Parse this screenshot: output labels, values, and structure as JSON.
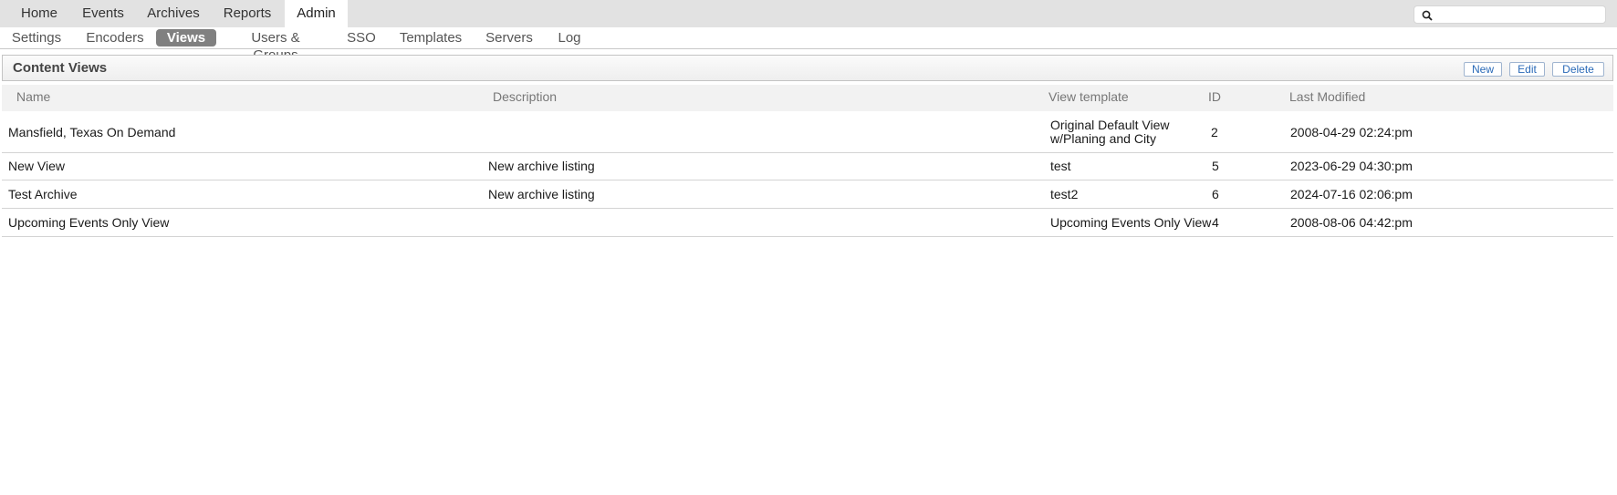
{
  "top_nav": {
    "tabs": [
      "Home",
      "Events",
      "Archives",
      "Reports",
      "Admin"
    ],
    "active": "Admin"
  },
  "search": {
    "placeholder": "",
    "value": "",
    "icon": "search-icon"
  },
  "sub_nav": {
    "tabs": [
      "Settings",
      "Encoders",
      "Views",
      "Users & Groups",
      "SSO",
      "Templates",
      "Servers",
      "Log"
    ],
    "active": "Views"
  },
  "panel": {
    "title": "Content Views",
    "buttons": {
      "new": "New",
      "edit": "Edit",
      "delete": "Delete"
    }
  },
  "table": {
    "columns": {
      "name": "Name",
      "description": "Description",
      "template": "View template",
      "id": "ID",
      "modified": "Last Modified"
    },
    "rows": [
      {
        "name": "Mansfield, Texas On Demand",
        "description": "",
        "template_line1": "Original Default View",
        "template_line2": "w/Planing and City",
        "id": "2",
        "modified": "2008-04-29 02:24:pm"
      },
      {
        "name": "New View",
        "description": "New archive listing",
        "template_line1": "test",
        "template_line2": "",
        "id": "5",
        "modified": "2023-06-29 04:30:pm"
      },
      {
        "name": "Test Archive",
        "description": "New archive listing",
        "template_line1": "test2",
        "template_line2": "",
        "id": "6",
        "modified": "2024-07-16 02:06:pm"
      },
      {
        "name": "Upcoming Events Only View",
        "description": "",
        "template_line1": "Upcoming Events Only View",
        "template_line2": "",
        "id": "4",
        "modified": "2008-08-06 04:42:pm"
      }
    ]
  },
  "colors": {
    "topbar_bg": "#e2e2e2",
    "active_subtab_bg": "#808080",
    "button_text": "#2a6ab8"
  }
}
